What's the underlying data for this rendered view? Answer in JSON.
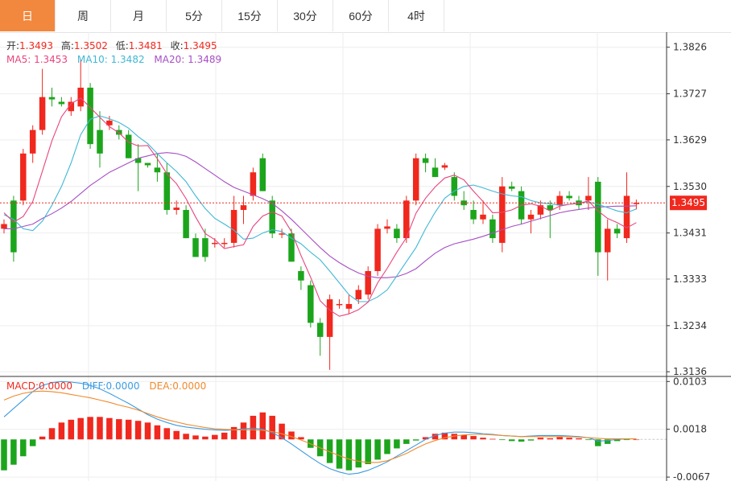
{
  "tabs": [
    {
      "label": "日",
      "active": true
    },
    {
      "label": "周",
      "active": false
    },
    {
      "label": "月",
      "active": false
    },
    {
      "label": "5分",
      "active": false
    },
    {
      "label": "15分",
      "active": false
    },
    {
      "label": "30分",
      "active": false
    },
    {
      "label": "60分",
      "active": false
    },
    {
      "label": "4时",
      "active": false
    }
  ],
  "ohlc_legend": {
    "open_label": "开:",
    "open": "1.3493",
    "high_label": "高:",
    "high": "1.3502",
    "low_label": "低:",
    "low": "1.3481",
    "close_label": "收:",
    "close": "1.3495"
  },
  "ma_legend": {
    "ma5_label": "MA5: ",
    "ma5": "1.3453",
    "ma10_label": "MA10: ",
    "ma10": "1.3482",
    "ma20_label": "MA20: ",
    "ma20": "1.3489"
  },
  "macd_legend": {
    "macd_label": "MACD:",
    "macd": "0.0000",
    "diff_label": "DIFF:",
    "diff": "0.0000",
    "dea_label": "DEA:",
    "dea": "0.0000"
  },
  "current_price_label": "1.3495",
  "colors": {
    "up": "#f0281e",
    "down": "#1ca51c",
    "ma5": "#e8457e",
    "ma10": "#3fb8d6",
    "ma20": "#a64fc4",
    "diff": "#3c9be0",
    "dea": "#ef8a2e",
    "price_tag": "#f0281e",
    "tab_active": "#f2883d"
  },
  "chart_data": {
    "type": "candlestick",
    "price_axis": {
      "ticks": [
        "1.3826",
        "1.3727",
        "1.3629",
        "1.3530",
        "1.3431",
        "1.3333",
        "1.3234",
        "1.3136"
      ],
      "range": [
        1.3126,
        1.3858
      ]
    },
    "macd_axis": {
      "ticks": [
        "0.0103",
        "0.0018",
        "-0.0067"
      ],
      "range": [
        -0.0074,
        0.0112
      ]
    },
    "candles": [
      [
        1.344,
        1.346,
        1.343,
        1.345
      ],
      [
        1.35,
        1.351,
        1.337,
        1.339
      ],
      [
        1.35,
        1.361,
        1.349,
        1.36
      ],
      [
        1.36,
        1.366,
        1.358,
        1.365
      ],
      [
        1.365,
        1.378,
        1.364,
        1.372
      ],
      [
        1.372,
        1.374,
        1.37,
        1.3715
      ],
      [
        1.371,
        1.372,
        1.37,
        1.3705
      ],
      [
        1.369,
        1.372,
        1.368,
        1.371
      ],
      [
        1.37,
        1.38,
        1.369,
        1.374
      ],
      [
        1.374,
        1.375,
        1.361,
        1.362
      ],
      [
        1.365,
        1.369,
        1.357,
        1.36
      ],
      [
        1.366,
        1.368,
        1.365,
        1.367
      ],
      [
        1.365,
        1.366,
        1.363,
        1.364
      ],
      [
        1.364,
        1.365,
        1.359,
        1.359
      ],
      [
        1.359,
        1.362,
        1.352,
        1.358
      ],
      [
        1.358,
        1.358,
        1.357,
        1.3575
      ],
      [
        1.357,
        1.36,
        1.354,
        1.356
      ],
      [
        1.356,
        1.358,
        1.347,
        1.348
      ],
      [
        1.348,
        1.35,
        1.347,
        1.3485
      ],
      [
        1.348,
        1.349,
        1.342,
        1.342
      ],
      [
        1.342,
        1.343,
        1.338,
        1.338
      ],
      [
        1.342,
        1.344,
        1.337,
        1.338
      ],
      [
        1.341,
        1.342,
        1.34,
        1.341
      ],
      [
        1.341,
        1.342,
        1.34,
        1.341
      ],
      [
        1.341,
        1.351,
        1.34,
        1.348
      ],
      [
        1.348,
        1.351,
        1.345,
        1.349
      ],
      [
        1.351,
        1.357,
        1.35,
        1.356
      ],
      [
        1.359,
        1.36,
        1.352,
        1.352
      ],
      [
        1.35,
        1.351,
        1.342,
        1.343
      ],
      [
        1.343,
        1.344,
        1.342,
        1.343
      ],
      [
        1.343,
        1.344,
        1.337,
        1.337
      ],
      [
        1.335,
        1.336,
        1.331,
        1.333
      ],
      [
        1.332,
        1.333,
        1.323,
        1.324
      ],
      [
        1.324,
        1.325,
        1.317,
        1.321
      ],
      [
        1.321,
        1.33,
        1.314,
        1.329
      ],
      [
        1.328,
        1.329,
        1.327,
        1.328
      ],
      [
        1.327,
        1.33,
        1.326,
        1.328
      ],
      [
        1.329,
        1.332,
        1.328,
        1.331
      ],
      [
        1.33,
        1.336,
        1.329,
        1.335
      ],
      [
        1.335,
        1.345,
        1.334,
        1.344
      ],
      [
        1.344,
        1.346,
        1.343,
        1.3445
      ],
      [
        1.344,
        1.345,
        1.341,
        1.342
      ],
      [
        1.342,
        1.351,
        1.341,
        1.35
      ],
      [
        1.35,
        1.36,
        1.349,
        1.359
      ],
      [
        1.359,
        1.36,
        1.356,
        1.358
      ],
      [
        1.357,
        1.359,
        1.355,
        1.355
      ],
      [
        1.357,
        1.358,
        1.3565,
        1.3575
      ],
      [
        1.355,
        1.356,
        1.35,
        1.351
      ],
      [
        1.35,
        1.352,
        1.348,
        1.349
      ],
      [
        1.348,
        1.35,
        1.345,
        1.346
      ],
      [
        1.346,
        1.35,
        1.345,
        1.347
      ],
      [
        1.346,
        1.347,
        1.341,
        1.342
      ],
      [
        1.341,
        1.355,
        1.339,
        1.353
      ],
      [
        1.353,
        1.354,
        1.352,
        1.3525
      ],
      [
        1.352,
        1.353,
        1.345,
        1.346
      ],
      [
        1.346,
        1.348,
        1.343,
        1.347
      ],
      [
        1.347,
        1.35,
        1.346,
        1.349
      ],
      [
        1.349,
        1.35,
        1.342,
        1.348
      ],
      [
        1.349,
        1.352,
        1.348,
        1.351
      ],
      [
        1.351,
        1.352,
        1.35,
        1.3505
      ],
      [
        1.35,
        1.351,
        1.348,
        1.349
      ],
      [
        1.35,
        1.355,
        1.348,
        1.351
      ],
      [
        1.354,
        1.355,
        1.334,
        1.339
      ],
      [
        1.339,
        1.346,
        1.333,
        1.344
      ],
      [
        1.344,
        1.345,
        1.342,
        1.343
      ],
      [
        1.342,
        1.356,
        1.341,
        1.351
      ],
      [
        1.3493,
        1.3502,
        1.3481,
        1.3495
      ]
    ],
    "ma5": [
      1.3474,
      1.3454,
      1.3466,
      1.3498,
      1.3562,
      1.3627,
      1.3678,
      1.3706,
      1.3718,
      1.3698,
      1.3677,
      1.3657,
      1.3644,
      1.3624,
      1.3616,
      1.3617,
      1.3589,
      1.3557,
      1.3536,
      1.3504,
      1.3465,
      1.343,
      1.3417,
      1.3398,
      1.3402,
      1.3406,
      1.3445,
      1.3467,
      1.3476,
      1.3467,
      1.3434,
      1.3383,
      1.3337,
      1.3287,
      1.3267,
      1.3254,
      1.3259,
      1.3268,
      1.3284,
      1.3325,
      1.3356,
      1.339,
      1.3421,
      1.3473,
      1.3505,
      1.3529,
      1.3548,
      1.3554,
      1.3544,
      1.352,
      1.3498,
      1.3474,
      1.3475,
      1.348,
      1.349,
      1.3493,
      1.3488,
      1.3478,
      1.3488,
      1.3492,
      1.3494,
      1.3499,
      1.3478,
      1.3462,
      1.3453,
      1.3442,
      1.3453
    ],
    "ma10": [
      1.347,
      1.346,
      1.344,
      1.3436,
      1.3456,
      1.349,
      1.353,
      1.358,
      1.364,
      1.3673,
      1.368,
      1.3674,
      1.3666,
      1.3654,
      1.3636,
      1.3621,
      1.36,
      1.358,
      1.3562,
      1.354,
      1.351,
      1.3483,
      1.3462,
      1.345,
      1.3437,
      1.3418,
      1.342,
      1.3431,
      1.3438,
      1.3434,
      1.342,
      1.3408,
      1.339,
      1.3374,
      1.335,
      1.3325,
      1.33,
      1.3285,
      1.3285,
      1.3295,
      1.331,
      1.334,
      1.337,
      1.34,
      1.344,
      1.3475,
      1.3505,
      1.352,
      1.353,
      1.3533,
      1.3527,
      1.352,
      1.3514,
      1.351,
      1.3508,
      1.35,
      1.3495,
      1.3493,
      1.349,
      1.3492,
      1.3495,
      1.3497,
      1.3492,
      1.3485,
      1.3478,
      1.3474,
      1.3482
    ],
    "ma20": [
      1.344,
      1.344,
      1.3445,
      1.345,
      1.3462,
      1.3472,
      1.3484,
      1.3498,
      1.3515,
      1.3532,
      1.3546,
      1.356,
      1.357,
      1.358,
      1.359,
      1.3595,
      1.36,
      1.3602,
      1.36,
      1.3594,
      1.3582,
      1.3568,
      1.3554,
      1.354,
      1.3528,
      1.352,
      1.3512,
      1.3504,
      1.3494,
      1.3478,
      1.346,
      1.344,
      1.342,
      1.34,
      1.3382,
      1.3368,
      1.3356,
      1.3346,
      1.3339,
      1.3336,
      1.3336,
      1.3338,
      1.3345,
      1.3355,
      1.3372,
      1.3388,
      1.34,
      1.3408,
      1.3413,
      1.3418,
      1.3424,
      1.3431,
      1.3438,
      1.3445,
      1.345,
      1.3456,
      1.3462,
      1.3468,
      1.3474,
      1.3478,
      1.3481,
      1.3484,
      1.3486,
      1.3487,
      1.3488,
      1.3488,
      1.3489
    ],
    "macd_hist": [
      -0.0055,
      -0.0045,
      -0.003,
      -0.0012,
      0.0005,
      0.002,
      0.003,
      0.0035,
      0.0038,
      0.004,
      0.004,
      0.0038,
      0.0036,
      0.0035,
      0.0033,
      0.003,
      0.0025,
      0.002,
      0.0015,
      0.001,
      0.0007,
      0.0005,
      0.0008,
      0.0012,
      0.0022,
      0.003,
      0.0042,
      0.0048,
      0.0042,
      0.0028,
      0.0014,
      0.0004,
      -0.0015,
      -0.003,
      -0.0042,
      -0.0052,
      -0.0055,
      -0.005,
      -0.0044,
      -0.0036,
      -0.0026,
      -0.0016,
      -0.0008,
      -0.0002,
      0.0004,
      0.001,
      0.0012,
      0.001,
      0.0008,
      0.0006,
      0.0003,
      0.0001,
      -0.0001,
      -0.0003,
      -0.0004,
      -0.0002,
      0.0003,
      0.0002,
      0.0004,
      0.0003,
      0.0002,
      -0.0001,
      -0.0012,
      -0.0008,
      -0.0003,
      -0.0001,
      0.0
    ],
    "diff": [
      0.004,
      0.0055,
      0.007,
      0.0085,
      0.0096,
      0.0101,
      0.0103,
      0.0102,
      0.01,
      0.0096,
      0.009,
      0.0082,
      0.0073,
      0.0064,
      0.0054,
      0.0044,
      0.0036,
      0.003,
      0.0025,
      0.0022,
      0.002,
      0.0018,
      0.0017,
      0.0016,
      0.0017,
      0.0019,
      0.002,
      0.0018,
      0.0012,
      0.0003,
      -0.0008,
      -0.002,
      -0.0032,
      -0.0043,
      -0.0052,
      -0.0058,
      -0.0062,
      -0.006,
      -0.0055,
      -0.0048,
      -0.004,
      -0.003,
      -0.002,
      -0.001,
      0.0,
      0.0007,
      0.0011,
      0.0013,
      0.0013,
      0.0012,
      0.001,
      0.0009,
      0.0007,
      0.0006,
      0.0005,
      0.0006,
      0.0007,
      0.0007,
      0.0007,
      0.0006,
      0.0005,
      0.0003,
      -0.0003,
      -0.0002,
      0.0,
      0.0001,
      0.0001
    ],
    "dea": [
      0.007,
      0.0077,
      0.0082,
      0.0085,
      0.0086,
      0.0085,
      0.0083,
      0.008,
      0.0077,
      0.0074,
      0.007,
      0.0066,
      0.0061,
      0.0057,
      0.0052,
      0.0046,
      0.004,
      0.0035,
      0.0031,
      0.0027,
      0.0024,
      0.0021,
      0.0019,
      0.0018,
      0.0017,
      0.0017,
      0.0017,
      0.0016,
      0.0014,
      0.001,
      0.0005,
      -0.0001,
      -0.0008,
      -0.0015,
      -0.0022,
      -0.0029,
      -0.0035,
      -0.0039,
      -0.0041,
      -0.0041,
      -0.0038,
      -0.0032,
      -0.0025,
      -0.0016,
      -0.0008,
      -0.0002,
      0.0003,
      0.0006,
      0.0008,
      0.0009,
      0.0009,
      0.0008,
      0.0007,
      0.0006,
      0.0005,
      0.0005,
      0.0005,
      0.0005,
      0.0005,
      0.0005,
      0.0004,
      0.0003,
      0.0002,
      0.0001,
      0.0001,
      0.0001,
      0.0001
    ]
  }
}
